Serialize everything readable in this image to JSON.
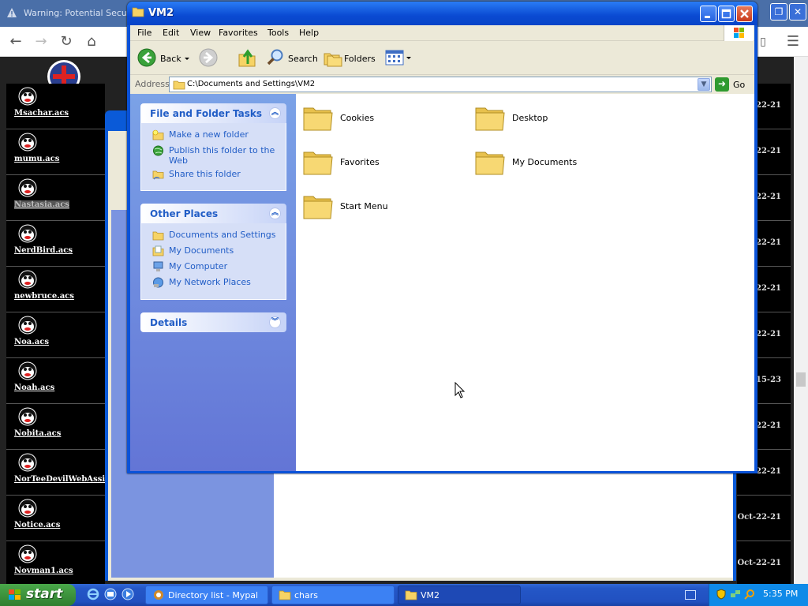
{
  "browser": {
    "title": "Warning: Potential Security",
    "char_list": [
      {
        "name": "Msachar.acs"
      },
      {
        "name": "mumu.acs"
      },
      {
        "name": "Nastasia.acs"
      },
      {
        "name": "NerdBird.acs"
      },
      {
        "name": "newbruce.acs"
      },
      {
        "name": "Noa.acs"
      },
      {
        "name": "Noah.acs"
      },
      {
        "name": "Nobita.acs"
      },
      {
        "name": "NorTeeDevilWebAssist"
      },
      {
        "name": "Notice.acs"
      },
      {
        "name": "Novman1.acs"
      }
    ],
    "dates": [
      "22-21",
      "22-21",
      "22-21",
      "22-21",
      "22-21",
      "22-21",
      "-15-23",
      "22-21",
      "22-21",
      "Oct-22-21",
      "Oct-22-21"
    ]
  },
  "window": {
    "title": "VM2",
    "menu": [
      "File",
      "Edit",
      "View",
      "Favorites",
      "Tools",
      "Help"
    ],
    "toolbar": {
      "back": "Back",
      "search": "Search",
      "folders": "Folders"
    },
    "address": {
      "label": "Address",
      "value": "C:\\Documents and Settings\\VM2",
      "go": "Go"
    },
    "file_tasks": {
      "title": "File and Folder Tasks",
      "items": [
        "Make a new folder",
        "Publish this folder to the Web",
        "Share this folder"
      ]
    },
    "other_places": {
      "title": "Other Places",
      "items": [
        "Documents and Settings",
        "My Documents",
        "My Computer",
        "My Network Places"
      ]
    },
    "details": {
      "title": "Details"
    },
    "folders": [
      "Cookies",
      "Desktop",
      "Favorites",
      "My Documents",
      "Start Menu"
    ]
  },
  "taskbar": {
    "start": "start",
    "tasks": [
      "Directory list - Mypal",
      "chars",
      "VM2"
    ],
    "clock": "5:35 PM"
  },
  "colors": {
    "xp_blue": "#0a52d8",
    "task_link": "#215dc6",
    "start_green": "#3a8f3a"
  }
}
